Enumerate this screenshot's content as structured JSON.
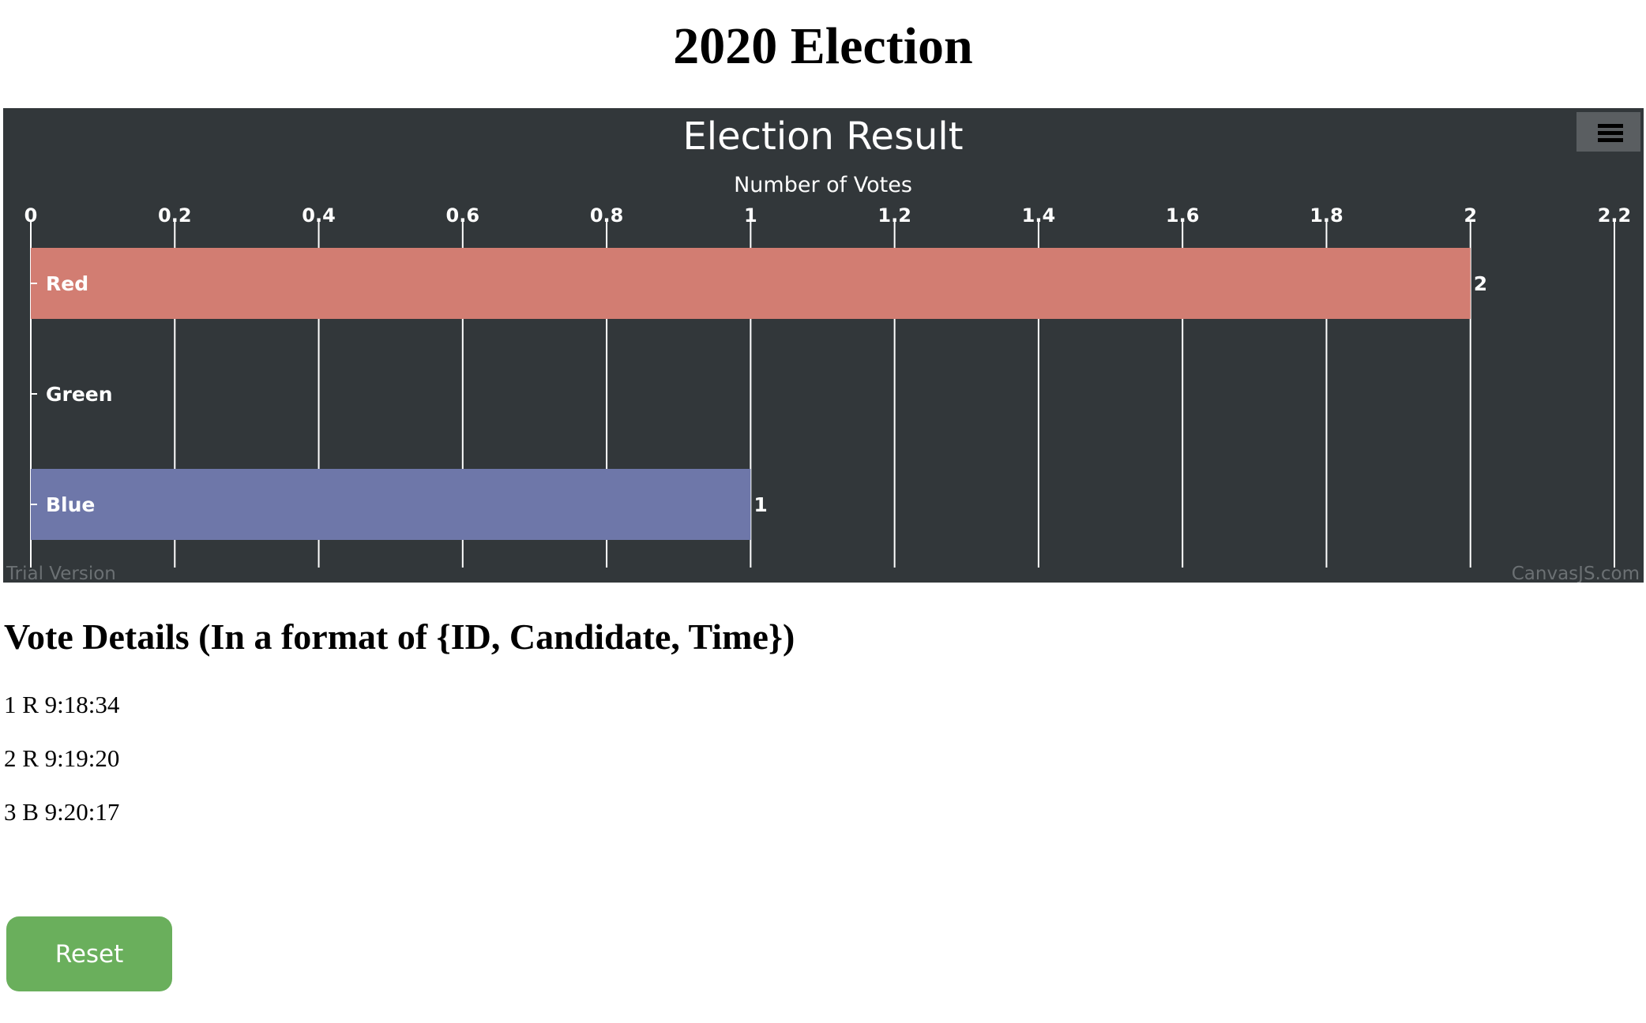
{
  "page": {
    "title": "2020 Election"
  },
  "chart_data": {
    "type": "bar",
    "orientation": "horizontal",
    "title": "Election Result",
    "axis_title": "Number of Votes",
    "categories": [
      "Red",
      "Green",
      "Blue"
    ],
    "values": [
      2,
      0,
      1
    ],
    "value_labels": [
      "2",
      "",
      "1"
    ],
    "colors": [
      "#d27d72",
      "#5fa868",
      "#6e77a9"
    ],
    "ticks": [
      "0",
      "0.2",
      "0.4",
      "0.6",
      "0.8",
      "1",
      "1.2",
      "1.4",
      "1.6",
      "1.8",
      "2",
      "2.2"
    ],
    "xlim": [
      0,
      2.2
    ],
    "grid": true,
    "axis_position": "top",
    "theme": "dark",
    "background": "#32373a",
    "watermark_left": "Trial Version",
    "watermark_right": "CanvasJS.com",
    "menu_icon": "hamburger-menu-icon"
  },
  "details": {
    "heading": "Vote Details (In a format of {ID, Candidate, Time})",
    "votes": [
      "1 R 9:18:34",
      "2 R 9:19:20",
      "3 B 9:20:17"
    ]
  },
  "controls": {
    "reset_label": "Reset",
    "reset_color": "#6aaf5c"
  }
}
